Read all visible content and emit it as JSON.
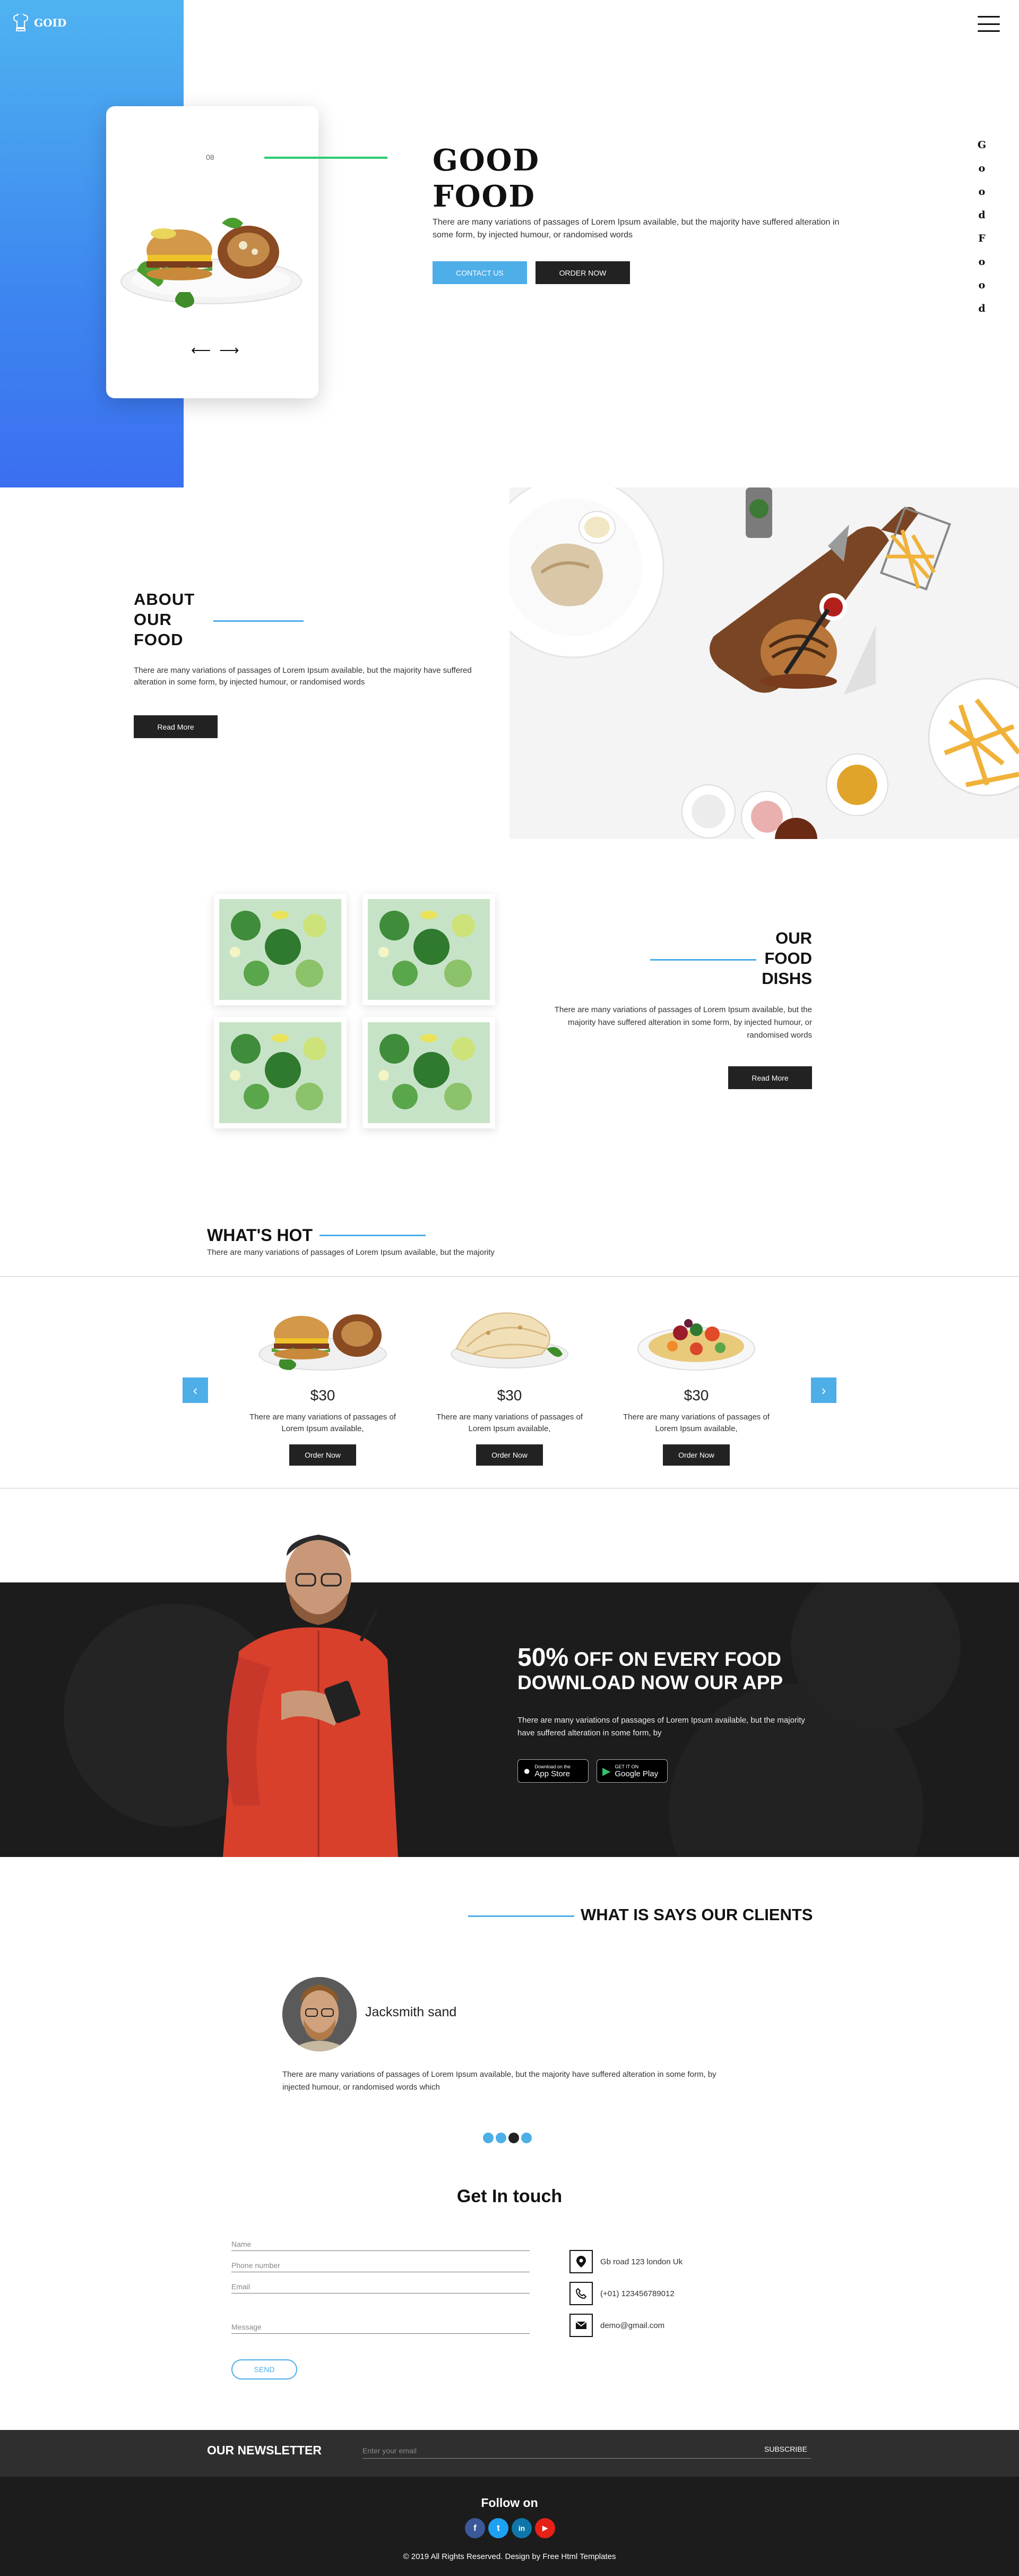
{
  "header": {
    "logo_text": "GOID",
    "logo_icon": "chef-hat-icon",
    "menu_icon": "hamburger-menu-icon"
  },
  "hero": {
    "card_index": "08",
    "title_line1": "GOOD",
    "title_line2": "FOOD",
    "text": "There are many variations of passages of Lorem Ipsum available, but the majority have suffered alteration in some form, by injected humour, or randomised words",
    "contact_label": "CONTACT US",
    "order_label": "ORDER NOW",
    "prev_arrow": "⟵",
    "next_arrow": "⟶",
    "vertical_letters": [
      "G",
      "o",
      "o",
      "d",
      "F",
      "o",
      "o",
      "d"
    ],
    "accent_color": "#4daee8"
  },
  "about": {
    "title": [
      "ABOUT",
      "OUR",
      "FOOD"
    ],
    "text": "There are many variations of passages of Lorem Ipsum available, but the majority have suffered alteration in some form, by injected humour, or randomised words",
    "button_label": "Read More"
  },
  "dishes": {
    "title": [
      "OUR",
      "FOOD",
      "DISHS"
    ],
    "text": "There are many variations of passages of Lorem Ipsum available, but the majority have suffered alteration in some form, by injected humour, or randomised words",
    "button_label": "Read More"
  },
  "whats_hot": {
    "title": "WHAT'S HOT",
    "subtitle": "There are many variations of passages of Lorem Ipsum available, but the majority",
    "prev_icon": "‹",
    "next_icon": "›",
    "items": [
      {
        "price": "$30",
        "desc": "There are many variations of passages of Lorem Ipsum available,",
        "button": "Order Now"
      },
      {
        "price": "$30",
        "desc": "There are many variations of passages of Lorem Ipsum available,",
        "button": "Order Now"
      },
      {
        "price": "$30",
        "desc": "There are many variations of passages of Lorem Ipsum available,",
        "button": "Order Now"
      }
    ]
  },
  "promo": {
    "title_line1_big": "50%",
    "title_line1_rest": " OFF ON EVERY FOOD",
    "title_line2": "DOWNLOAD NOW OUR APP",
    "text": "There are many variations of passages of Lorem Ipsum available, but the majority have suffered alteration in some form, by",
    "app_store_small": "Download on the",
    "app_store_big": "App Store",
    "google_play_small": "GET IT ON",
    "google_play_big": "Google Play"
  },
  "clients": {
    "title": "WHAT IS SAYS OUR CLIENTS",
    "name": "Jacksmith sand",
    "text": "There are many variations of passages of Lorem Ipsum available, but the majority have suffered alteration in some form, by injected humour, or randomised words which"
  },
  "contact": {
    "title": "Get In touch",
    "name_placeholder": "Name",
    "phone_placeholder": "Phone number",
    "email_placeholder": "Email",
    "message_placeholder": "Message",
    "send_label": "SEND",
    "address": "Gb road 123 london Uk",
    "phone": "(+01) 123456789012",
    "email": "demo@gmail.com"
  },
  "newsletter": {
    "title": "OUR NEWSLETTER",
    "placeholder": "Enter your email",
    "button": "SUBSCRIBE"
  },
  "footer": {
    "follow": "Follow on",
    "social": [
      {
        "letter": "f",
        "color": "#3b5998"
      },
      {
        "letter": "t",
        "color": "#1da1f2"
      },
      {
        "letter": "in",
        "color": "#0e76a8"
      },
      {
        "letter": "▶",
        "color": "#e62117"
      }
    ],
    "copyright": "© 2019 All Rights Reserved. Design by Free Html Templates"
  }
}
